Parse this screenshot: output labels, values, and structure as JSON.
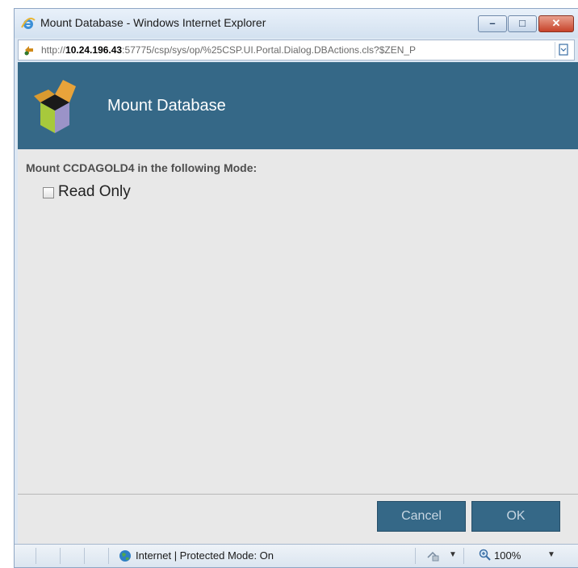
{
  "window": {
    "title": "Mount Database - Windows Internet Explorer",
    "controls": {
      "minimize": "–",
      "maximize": "□",
      "close": "✕"
    }
  },
  "address_bar": {
    "prefix": "http://",
    "host": "10.24.196.43",
    "rest": ":57775/csp/sys/op/%25CSP.UI.Portal.Dialog.DBActions.cls?$ZEN_P"
  },
  "dialog": {
    "banner_title": "Mount Database",
    "prompt": "Mount CCDAGOLD4 in the following Mode:",
    "read_only_label": "Read Only",
    "read_only_checked": false,
    "cancel_label": "Cancel",
    "ok_label": "OK"
  },
  "status_bar": {
    "zone_text": "Internet | Protected Mode: On",
    "zoom": "100%"
  },
  "colors": {
    "banner": "#356887",
    "button": "#356887",
    "content_bg": "#e8e8e8",
    "close_button": "#c7432a"
  }
}
